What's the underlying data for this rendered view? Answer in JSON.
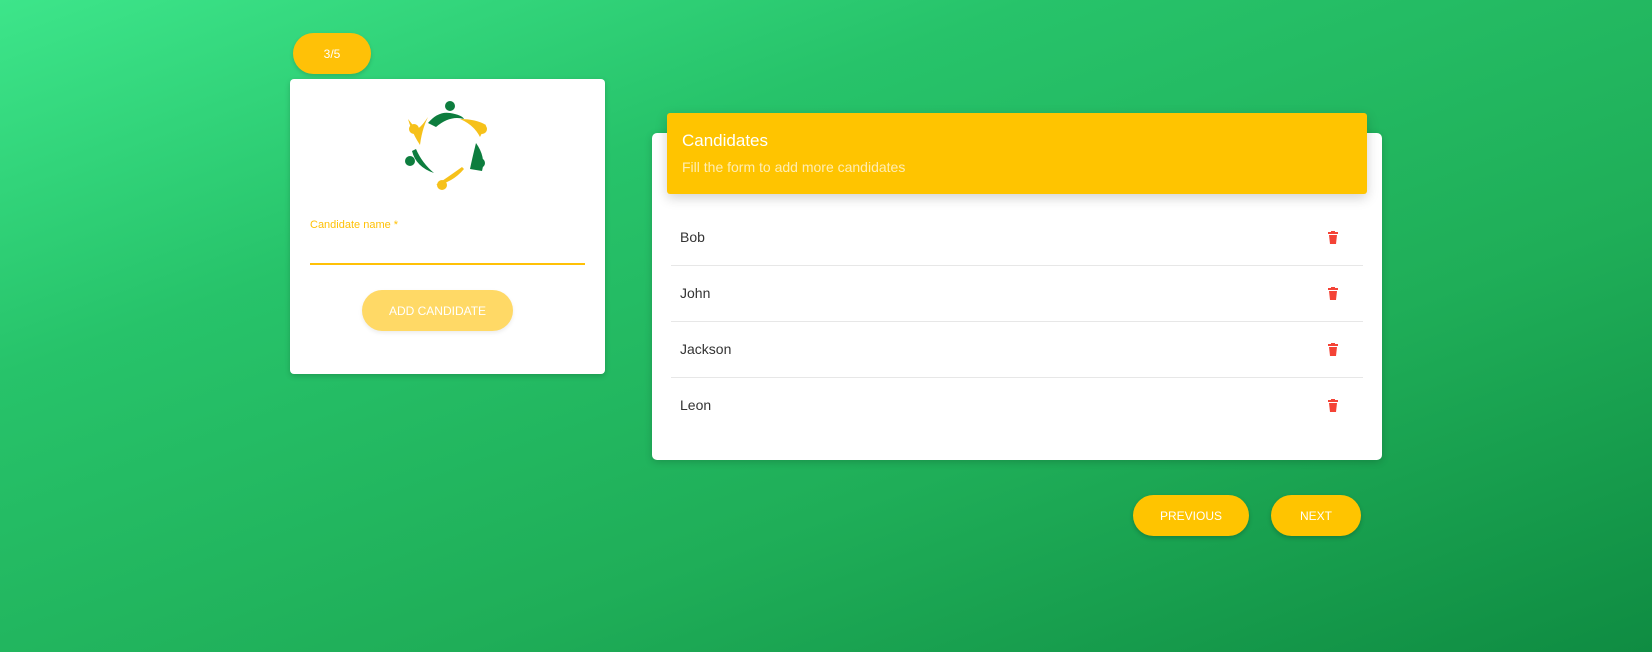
{
  "step": {
    "label": "3/5"
  },
  "form": {
    "logo_icon": "people-circle-logo",
    "field_label": "Candidate name *",
    "field_value": "",
    "add_button": "ADD CANDIDATE"
  },
  "candidates": {
    "title": "Candidates",
    "subtitle": "Fill the form to add more candidates",
    "items": [
      {
        "name": "Bob"
      },
      {
        "name": "John"
      },
      {
        "name": "Jackson"
      },
      {
        "name": "Leon"
      }
    ],
    "delete_icon": "trash-icon"
  },
  "nav": {
    "previous": "PREVIOUS",
    "next": "NEXT"
  },
  "colors": {
    "accent": "#ffc400",
    "delete": "#f44336",
    "logo_green": "#0d7d3e",
    "logo_yellow": "#f6c11a"
  }
}
